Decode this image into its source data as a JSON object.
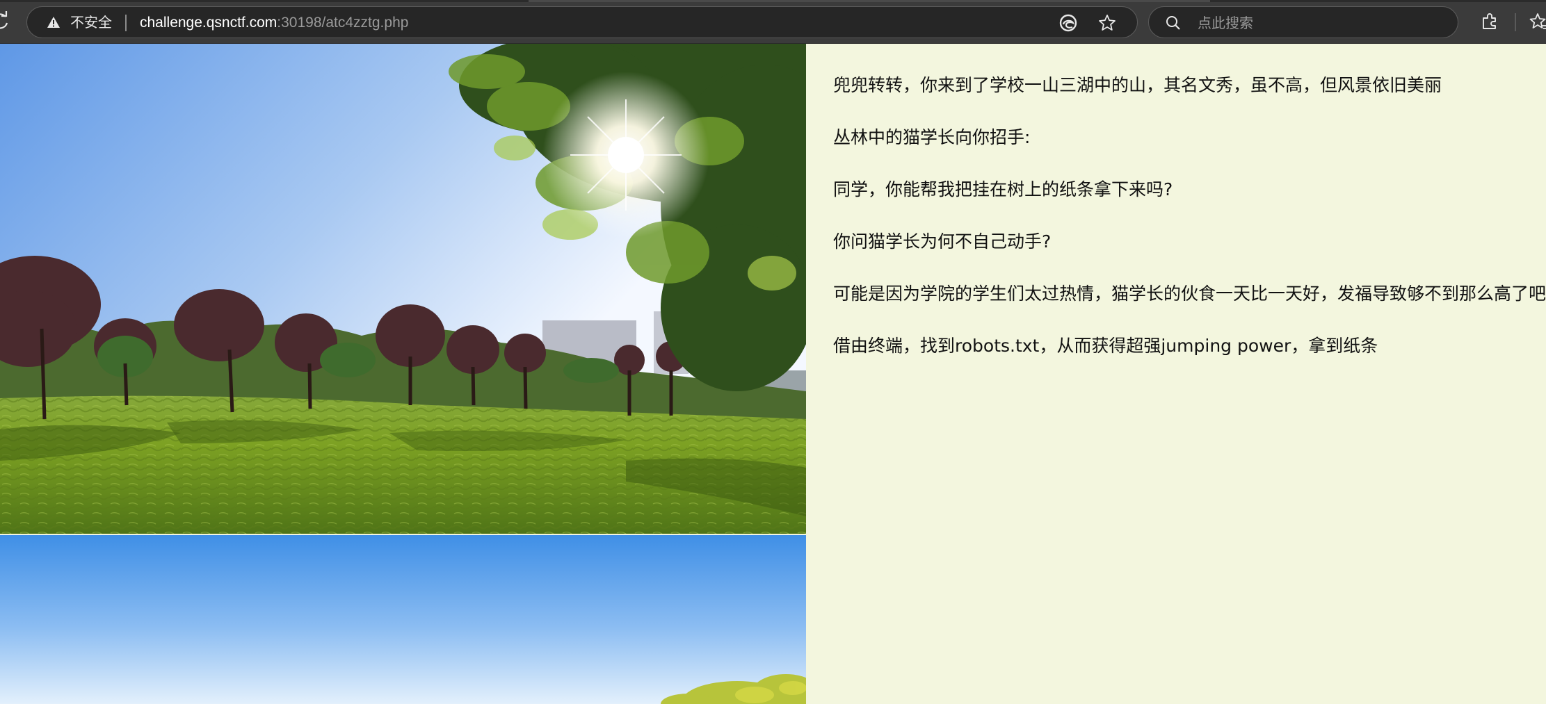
{
  "browser": {
    "security_label": "不安全",
    "url_host": "challenge.qsnctf.com",
    "url_rest": ":30198/atc4zztg.php",
    "search_placeholder": "点此搜索"
  },
  "icons": {
    "reload": "reload-icon",
    "warning": "warning-icon",
    "edge": "edge-icon",
    "favorite": "star-icon",
    "search": "search-icon",
    "extensions": "puzzle-icon",
    "favorites_bar": "favorites-icon"
  },
  "colors": {
    "toolbar": "#3b3b3b",
    "page_background": "#f3f6de",
    "text": "#111111"
  },
  "story": {
    "lines": [
      "兜兜转转，你来到了学校一山三湖中的山，其名文秀，虽不高，但风景依旧美丽",
      "丛林中的猫学长向你招手:",
      "同学，你能帮我把挂在树上的纸条拿下来吗?",
      "你问猫学长为何不自己动手?",
      "可能是因为学院的学生们太过热情，猫学长的伙食一天比一天好，发福导致够不到那么高了吧......",
      "借由终端，找到robots.txt，从而获得超强jumping power，拿到纸条"
    ]
  }
}
